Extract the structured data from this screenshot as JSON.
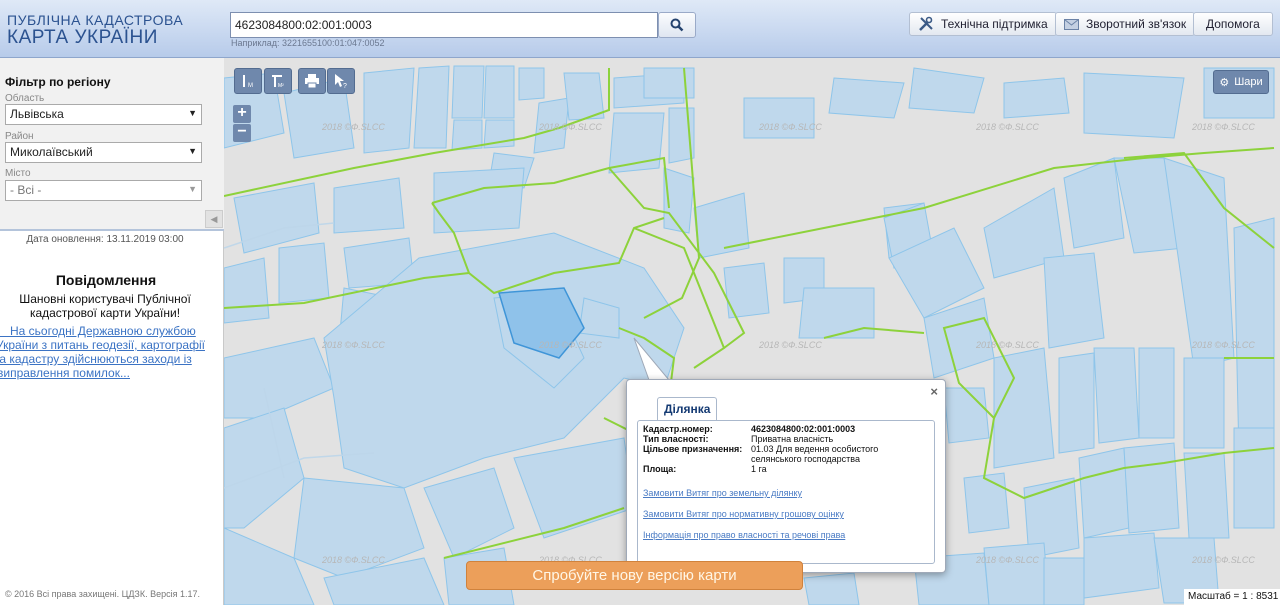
{
  "header": {
    "logo_line1": "ПУБЛІЧНА КАДАСТРОВА",
    "logo_line2": "КАРТА УКРАЇНИ",
    "search_value": "4623084800:02:001:0003",
    "search_hint": "Наприклад: 3221655100:01:047:0052",
    "support_label": "Технічна підтримка",
    "feedback_label": "Зворотний зв'язок",
    "help_label": "Допомога"
  },
  "sidebar": {
    "filter_title": "Фільтр по регіону",
    "region_label": "Область",
    "region_value": "Львівська",
    "district_label": "Район",
    "district_value": "Миколаївський",
    "city_label": "Місто",
    "city_value": "- Всі -",
    "updated": "Дата оновлення: 13.11.2019 03:00",
    "message_title": "Повідомлення",
    "message_line1": "Шановні користувачі Публічної",
    "message_line2": "кадастрової карти України!",
    "message_link_line1": "   На сьогодні Державною службою",
    "message_link_line2": "України з питань геодезії, картографії",
    "message_link_line3": "та кадастру здійснюються заходи із",
    "message_link_line4": "виправлення помилок...",
    "copyright": "© 2016 Всі права захищені. ЦДЗК. Версія 1.17."
  },
  "map": {
    "zoom_in": "+",
    "zoom_out": "−",
    "layers_label": "Шари",
    "watermark": "2018 ©Ф.SLCC",
    "new_version": "Спробуйте нову версію карти",
    "scale": "Масштаб = 1 : 8531"
  },
  "popup": {
    "close": "×",
    "tab": "Ділянка",
    "cadastral_label": "Кадастр.номер:",
    "cadastral_value": "4623084800:02:001:0003",
    "ownership_label": "Тип власності:",
    "ownership_value": "Приватна власність",
    "purpose_label": "Цільове призначення:",
    "purpose_value": "01.03 Для ведення особистого селянського господарства",
    "area_label": "Площа:",
    "area_value": "1 га",
    "link1": "Замовити Витяг про земельну ділянку",
    "link2": "Замовити Витяг про нормативну грошову оцінку",
    "link3": "Інформація про право власності та речові права"
  },
  "colors": {
    "parcel_fill": "#bfd8ec",
    "parcel_stroke": "#8ec5ea",
    "boundary": "#8dd23b",
    "map_bg": "#e2e2e2",
    "toolbar": "#6f88ac",
    "new_version_bg": "#ec9f5a"
  }
}
